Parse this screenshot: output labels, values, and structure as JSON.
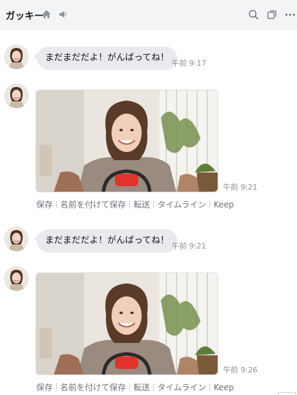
{
  "header": {
    "title": "ガッキー",
    "icons": [
      "home-icon",
      "speaker-icon",
      "search-icon",
      "copy-window-icon",
      "more-icon"
    ]
  },
  "messages": [
    {
      "type": "text",
      "text": "まだまだだよ！がんばってね！",
      "time": "午前 9:17"
    },
    {
      "type": "image",
      "time": "午前 9:21"
    },
    {
      "type": "text",
      "text": "まだまだだよ！がんばってね！",
      "time": "午前 9:21"
    },
    {
      "type": "image",
      "time": "午前 9:26"
    }
  ],
  "image_actions": [
    "保存",
    "名前を付けて保存",
    "転送",
    "タイムライン",
    "Keep"
  ],
  "colors": {
    "header_bg": "#f3f4f6",
    "bubble_bg": "#e8eaee",
    "time_text": "#8a8f98",
    "action_text": "#6b7078"
  }
}
